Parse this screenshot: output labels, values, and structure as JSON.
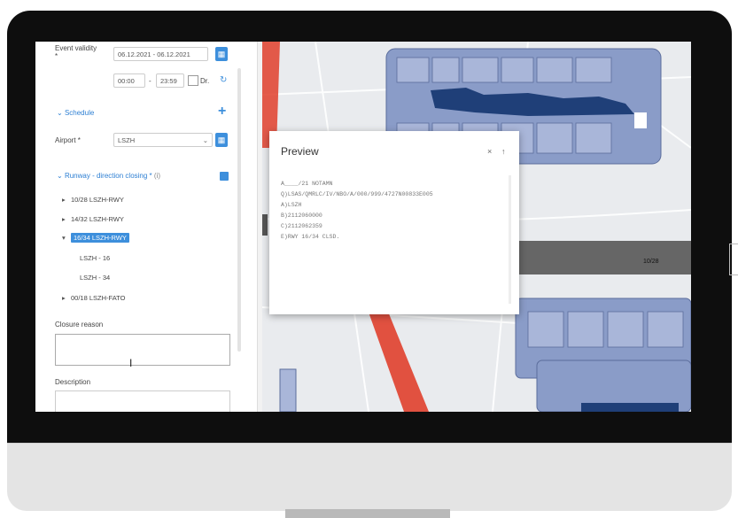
{
  "form": {
    "event_validity_label": "Event validity *",
    "date_range": "06.12.2021 - 06.12.2021",
    "time_from": "00:00",
    "time_separator": "-",
    "time_to": "23:59",
    "dr_label": "Dr.",
    "schedule_label": "Schedule",
    "airport_label": "Airport *",
    "airport_value": "LSZH",
    "runway_section_label": "Runway - direction closing *",
    "tree_items": [
      {
        "label": "10/28 LSZH-RWY",
        "expanded": false
      },
      {
        "label": "14/32 LSZH-RWY",
        "expanded": false
      },
      {
        "label": "16/34 LSZH-RWY",
        "expanded": true,
        "selected": true
      }
    ],
    "sub_items": [
      "LSZH - 16",
      "LSZH - 34"
    ],
    "fato_item": "00/18 LSZH-FATO",
    "closure_reason_label": "Closure reason",
    "description_label": "Description"
  },
  "preview": {
    "title": "Preview",
    "lines": [
      "A____/21 NOTAMN",
      "Q)LSAS/QMRLC/IV/NBO/A/000/999/4727N00833E005",
      "A)LSZH",
      "B)2112060000",
      "C)2112062359",
      "E)RWY 16/34 CLSD."
    ]
  },
  "map": {
    "runway_label": "10/28"
  },
  "colors": {
    "accent": "#3d8fdc",
    "building": "#8a9cc8",
    "building_dark": "#1f3f78",
    "runway_red": "#e0402c",
    "runway_gray": "#666666"
  }
}
